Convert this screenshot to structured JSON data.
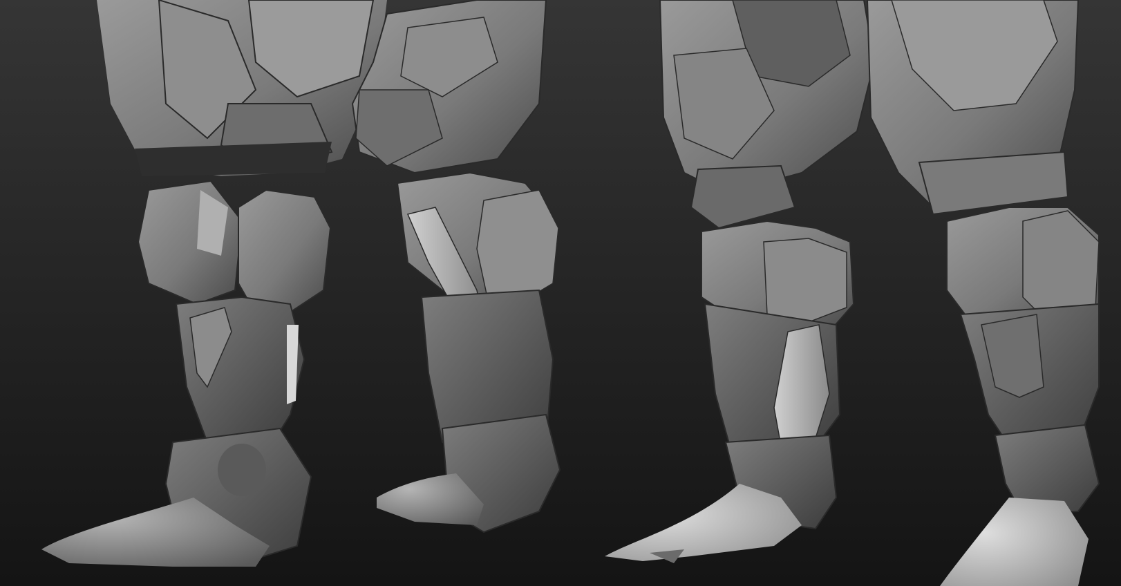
{
  "scene": {
    "kind": "sculpt-render",
    "background": {
      "top": "#353535",
      "bottom": "#141414"
    },
    "material": {
      "base": "#7d7d7d",
      "shadow": "#3a3a3a",
      "highlight": "#c4c4c4",
      "seam": "#262626"
    },
    "views": [
      {
        "name": "front-three-quarter",
        "legs": 2
      },
      {
        "name": "back-three-quarter",
        "legs": 2
      }
    ]
  }
}
